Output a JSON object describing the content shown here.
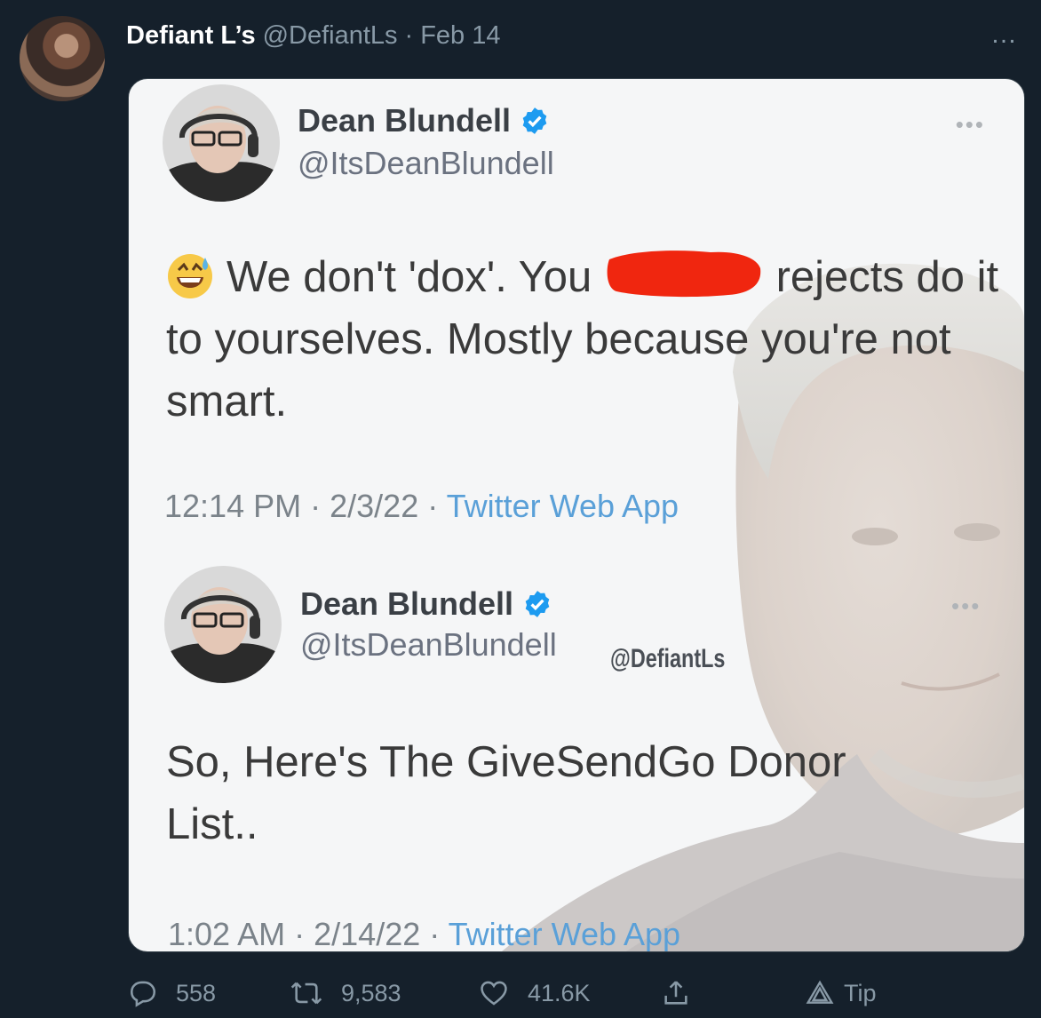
{
  "post": {
    "author_name": "Defiant L’s",
    "author_handle": "@DefiantLs",
    "separator": "·",
    "date": "Feb 14",
    "more_icon": "…"
  },
  "embedded_image": {
    "tweets": [
      {
        "name": "Dean Blundell",
        "handle": "@ItsDeanBlundell",
        "text_before": "We don't 'dox'.  You",
        "text_after": "rejects do it to yourselves.  Mostly because you're not smart.",
        "time": "12:14 PM",
        "date": "2/3/22",
        "app": "Twitter Web App"
      },
      {
        "name": "Dean Blundell",
        "handle": "@ItsDeanBlundell",
        "text": "So, Here's The GiveSendGo Donor List..",
        "time": "1:02 AM",
        "date": "2/14/22",
        "app": "Twitter Web App"
      }
    ],
    "watermark": "@DefiantLs",
    "meta_separator": "·",
    "icons": [
      "verified-badge-icon",
      "sweat-smile-emoji-icon",
      "red-redaction-mark"
    ],
    "colors": {
      "verified": "#1d9bf0",
      "redaction": "#f0260f",
      "link": "#5aa0d8"
    }
  },
  "actions": {
    "reply_count": "558",
    "retweet_count": "9,583",
    "like_count": "41.6K",
    "tip_label": "Tip"
  },
  "theme": {
    "background": "#15202b",
    "muted": "#8899a6"
  }
}
